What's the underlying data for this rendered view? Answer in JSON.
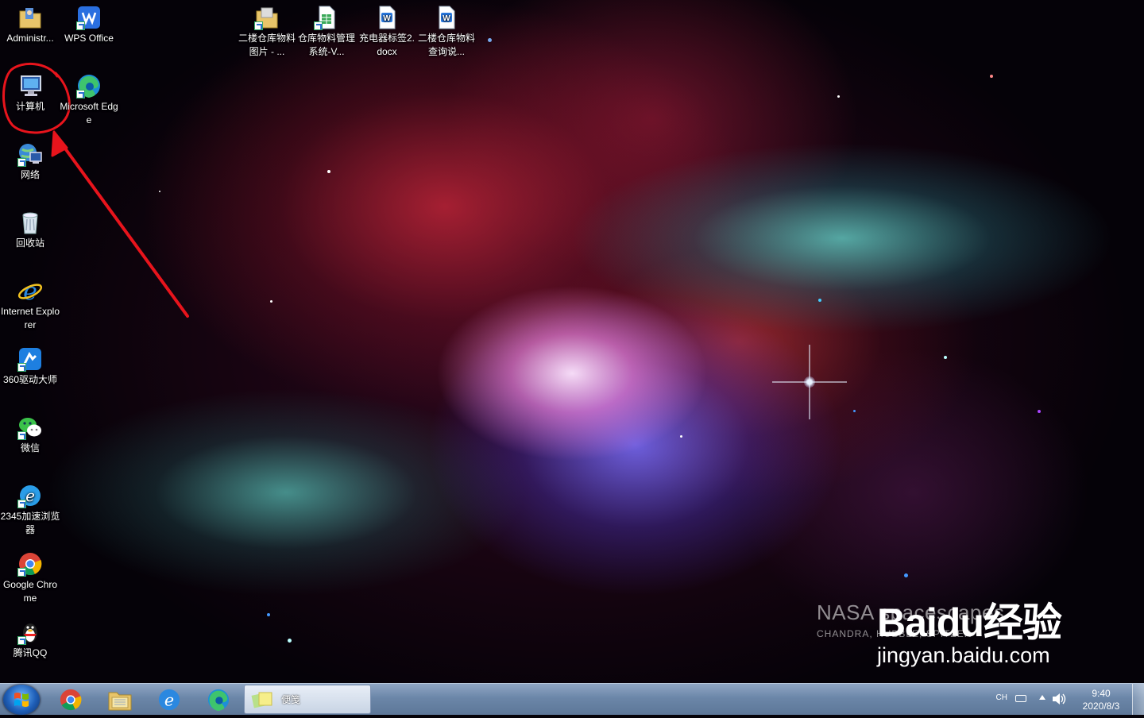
{
  "desktop_icons": {
    "administrator": "Administr...",
    "wps": "WPS Office",
    "computer": "计算机",
    "edge": "Microsoft Edge",
    "network": "网络",
    "recycle": "回收站",
    "ie": "Internet Explorer",
    "driver360": "360驱动大师",
    "wechat": "微信",
    "browser2345": "2345加速浏览器",
    "chrome": "Google Chrome",
    "qq": "腾讯QQ",
    "file1": "二楼仓库物料图片 - ...",
    "file2": "仓库物料管理系统-V...",
    "file3": "充电器标签2.docx",
    "file4": "二楼仓库物料查询说..."
  },
  "watermark": {
    "line1": "NASA spacescapes",
    "line2": "CHANDRA, HUBBLE, SPITZER"
  },
  "baidu_watermark": {
    "logo": "Baidu经验",
    "url": "jingyan.baidu.com"
  },
  "taskbar": {
    "active_window_label": "便笺",
    "language": "CH",
    "time": "9:40",
    "date": "2020/8/3"
  },
  "colors": {
    "annotation": "#e8141c",
    "taskbar": "#6b86a8"
  }
}
